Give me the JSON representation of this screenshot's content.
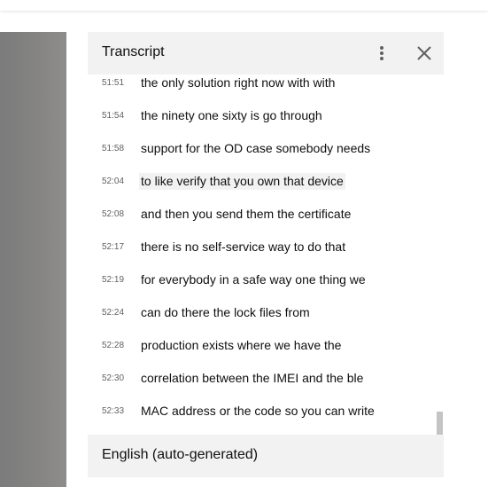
{
  "transcript_panel": {
    "title": "Transcript",
    "more_icon": "more-vertical-icon",
    "close_icon": "close-icon",
    "segments": [
      {
        "time": "51:51",
        "text": "the only solution right now with with",
        "active": false
      },
      {
        "time": "51:54",
        "text": "the ninety one sixty is go through",
        "active": false
      },
      {
        "time": "51:58",
        "text": "support for the OD case somebody needs",
        "active": false
      },
      {
        "time": "52:04",
        "text": "to like verify that you own that device",
        "active": true
      },
      {
        "time": "52:08",
        "text": "and then you send them the certificate",
        "active": false
      },
      {
        "time": "52:17",
        "text": "there is no self-service way to do that",
        "active": false
      },
      {
        "time": "52:19",
        "text": "for everybody in a safe way one thing we",
        "active": false
      },
      {
        "time": "52:24",
        "text": "can do there the lock files from",
        "active": false
      },
      {
        "time": "52:28",
        "text": "production exists where we have the",
        "active": false
      },
      {
        "time": "52:30",
        "text": "correlation between the IMEI and the ble",
        "active": false
      },
      {
        "time": "52:33",
        "text": "MAC address or the code so you can write",
        "active": false
      }
    ],
    "language": "English (auto-generated)"
  },
  "colors": {
    "header_bg": "#f2f2f2",
    "active_segment_bg": "#f2f2f2",
    "timestamp": "#606060",
    "text": "#0f0f0f"
  }
}
